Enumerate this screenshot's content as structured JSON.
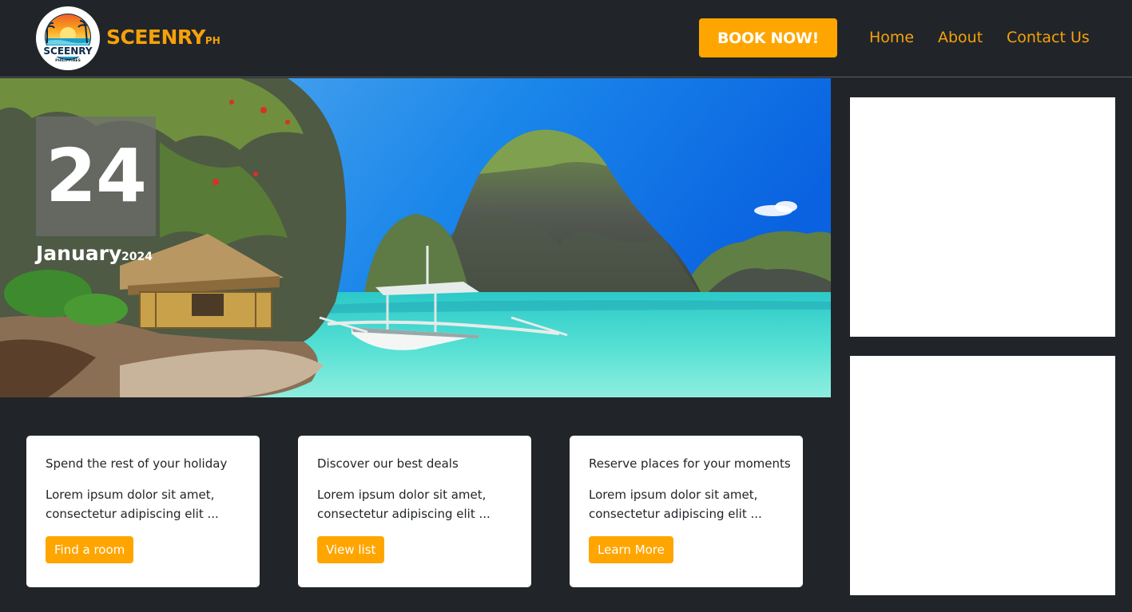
{
  "brand": {
    "name": "SCEENRY",
    "suffix": "PH",
    "logo_text": "SCEENRY",
    "logo_subtext": "PHILIPPINES"
  },
  "nav": {
    "book_label": "BOOK NOW!",
    "links": [
      "Home",
      "About",
      "Contact Us"
    ]
  },
  "hero": {
    "day": "24",
    "month": "January",
    "year": "2024",
    "image": "tropical-lagoon-with-boat"
  },
  "cards": [
    {
      "title": "Spend the rest of your holiday",
      "text": "Lorem ipsum dolor sit amet, consectetur adipiscing elit ...",
      "button": "Find a room"
    },
    {
      "title": "Discover our best deals",
      "text": "Lorem ipsum dolor sit amet, consectetur adipiscing elit ...",
      "button": "View list"
    },
    {
      "title": "Reserve places for your moments",
      "text": "Lorem ipsum dolor sit amet, consectetur adipiscing elit ...",
      "button": "Learn More"
    }
  ],
  "colors": {
    "background": "#212529",
    "accent": "#ffa500",
    "brand_text": "#f6a10a",
    "card_bg": "#ffffff",
    "ad_bg": "#ffffff"
  }
}
